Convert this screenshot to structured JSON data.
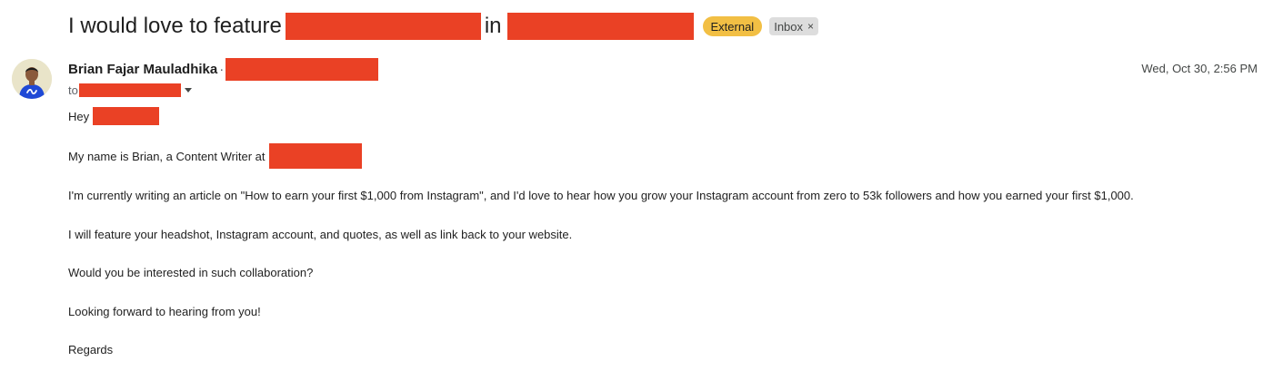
{
  "subject": {
    "part1": "I would love to feature",
    "part2": "in",
    "labels": {
      "external": "External",
      "inbox": "Inbox",
      "remove": "×"
    }
  },
  "colors": {
    "redaction": "#ea4125",
    "external_label": "#f2bf44",
    "inbox_label": "#dddddd"
  },
  "sender": {
    "name": "Brian Fajar Mauladhika",
    "separator": "·",
    "avatar_icon": "user-avatar-icon"
  },
  "recipient": {
    "prefix": "to"
  },
  "date": "Wed, Oct 30, 2:56 PM",
  "body": {
    "greeting": "Hey",
    "intro": "My name is Brian, a Content Writer at",
    "para1": "I'm currently writing an article on \"How to earn your first $1,000 from Instagram\", and I'd love to hear how you grow your Instagram account from zero to 53k followers and how you earned your first $1,000.",
    "para2": "I will feature your headshot, Instagram account, and quotes, as well as link back to your website.",
    "para3": "Would you be interested in such collaboration?",
    "para4": "Looking forward to hearing from you!",
    "signoff": "Regards"
  }
}
